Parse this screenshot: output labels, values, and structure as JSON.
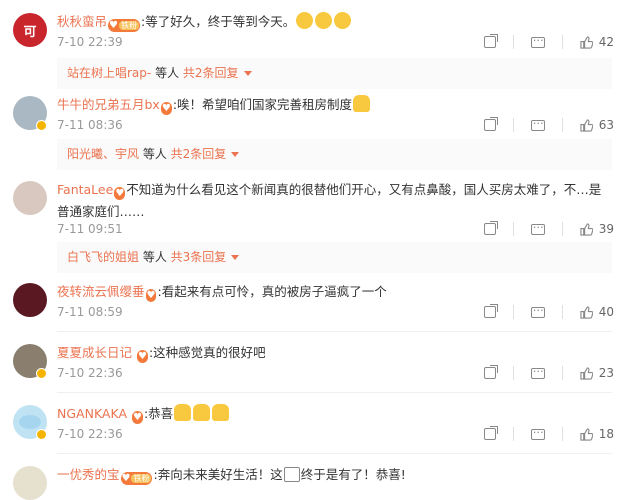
{
  "comments": [
    {
      "username": "秋秋蛮吊",
      "badge": "铁粉",
      "text": ":等了好久，终于等到今天。",
      "time": "7-10 22:39",
      "likes": "42",
      "replies": {
        "names": "站在树上唱rap-",
        "suffix": " 等人 ",
        "more": "共2条回复"
      }
    },
    {
      "username": "牛牛的兄弟五月bx",
      "badge": "",
      "text": ":唉！希望咱们国家完善租房制度",
      "time": "7-11 08:36",
      "likes": "63",
      "replies": {
        "names": "阳光曦、宇风",
        "suffix": " 等人 ",
        "more": "共2条回复"
      }
    },
    {
      "username": "FantaLee",
      "badge": "",
      "text": "不知道为什么看见这个新闻真的很替他们开心，又有点鼻酸，国人买房太难了，不…是普通家庭们……",
      "time": "7-11 09:51",
      "likes": "39",
      "replies": {
        "names": "白飞飞的姐姐",
        "suffix": " 等人 ",
        "more": "共3条回复"
      }
    },
    {
      "username": "夜转流云佩缨垂",
      "badge": "",
      "text": ":看起来有点可怜，真的被房子逼疯了一个",
      "time": "7-11 08:59",
      "likes": "40"
    },
    {
      "username": "夏夏成长日记",
      "badge": "",
      "text": ":这种感觉真的很好吧",
      "time": "7-10 22:36",
      "likes": "23"
    },
    {
      "username": "NGANKAKA",
      "badge": "",
      "text": ":恭喜",
      "time": "7-10 22:36",
      "likes": "18"
    },
    {
      "username": "一优秀的宝",
      "badge": "铁粉",
      "text": ":奔向未来美好生活！这",
      "text2": "终于是有了！恭喜!"
    }
  ],
  "colors": {
    "username": "#eb7350",
    "meta": "#999999",
    "reply_bg": "#fafafa"
  },
  "icons": [
    "share-icon",
    "reply-icon",
    "like-icon",
    "heart-icon",
    "emoji-icon"
  ]
}
